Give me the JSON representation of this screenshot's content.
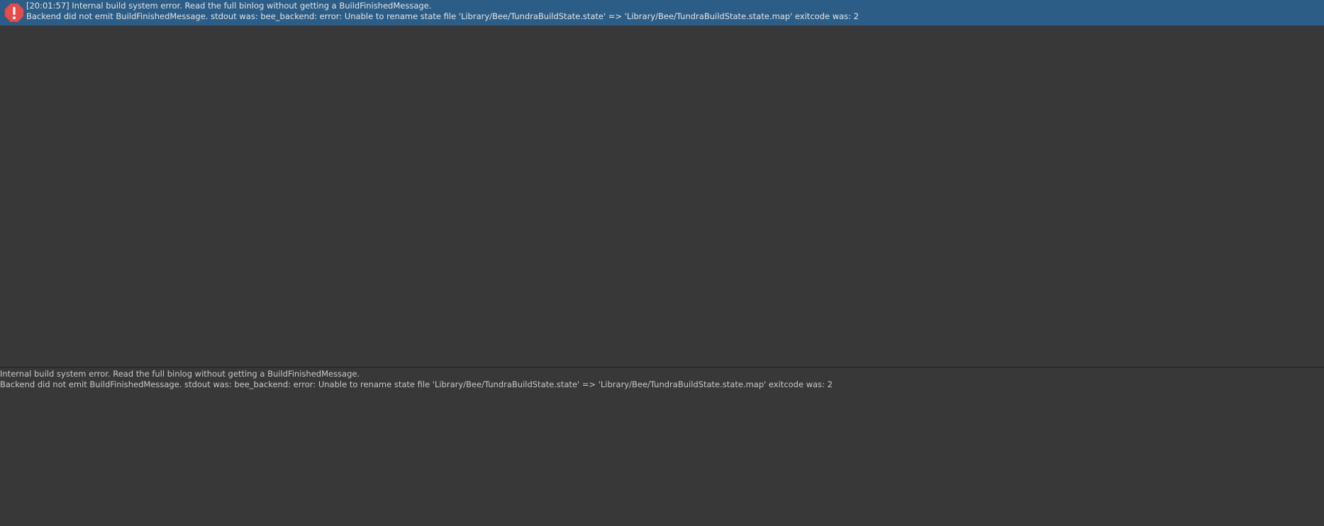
{
  "log": {
    "entries": [
      {
        "icon": "error-icon",
        "line1": "[20:01:57] Internal build system error. Read the full binlog without getting a BuildFinishedMessage.",
        "line2": "Backend did not emit BuildFinishedMessage. stdout was: bee_backend: error: Unable to rename state file 'Library/Bee/TundraBuildState.state' => 'Library/Bee/TundraBuildState.state.map' exitcode was: 2"
      }
    ]
  },
  "details": {
    "line1": "Internal build system error. Read the full binlog without getting a BuildFinishedMessage.",
    "line2": "Backend did not emit BuildFinishedMessage. stdout was: bee_backend: error: Unable to rename state file 'Library/Bee/TundraBuildState.state' => 'Library/Bee/TundraBuildState.state.map' exitcode was: 2"
  },
  "colors": {
    "background": "#383838",
    "selected_row": "#2c5d87",
    "error_icon": "#e84a4a"
  }
}
